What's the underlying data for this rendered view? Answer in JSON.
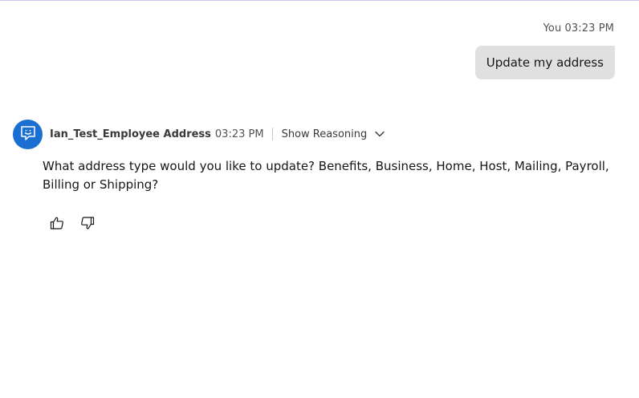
{
  "user_message": {
    "sender": "You",
    "time": "03:23 PM",
    "text": "Update my address"
  },
  "bot_message": {
    "name": "Ian_Test_Employee Address",
    "time": "03:23 PM",
    "reasoning_label": "Show Reasoning",
    "text": "What address type would you like to update? Benefits, Business, Home, Host, Mailing, Payroll, Billing or Shipping?",
    "avatar_icon": "chat-bot-icon"
  },
  "feedback": {
    "like_icon": "thumbs-up-icon",
    "dislike_icon": "thumbs-down-icon"
  },
  "colors": {
    "accent": "#1a6fd0",
    "user_bubble": "#e0e0e0",
    "top_border": "#c9c7ee"
  }
}
